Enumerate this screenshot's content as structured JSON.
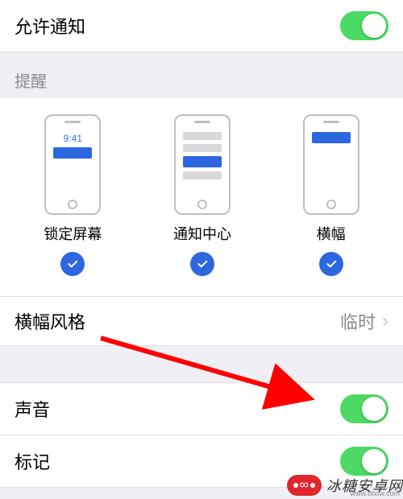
{
  "allow_notifications": {
    "label": "允许通知",
    "on": true
  },
  "alerts_header": "提醒",
  "alerts": {
    "lock_screen": {
      "label": "锁定屏幕",
      "time": "9:41",
      "checked": true
    },
    "notification_center": {
      "label": "通知中心",
      "checked": true
    },
    "banners": {
      "label": "横幅",
      "checked": true
    }
  },
  "banner_style": {
    "label": "横幅风格",
    "value": "临时"
  },
  "sounds": {
    "label": "声音",
    "on": true
  },
  "badges": {
    "label": "标记",
    "on": true
  },
  "watermark": {
    "brand_glyph": "∞",
    "text": "冰糖安卓网",
    "url": "www.btxtw.com"
  }
}
